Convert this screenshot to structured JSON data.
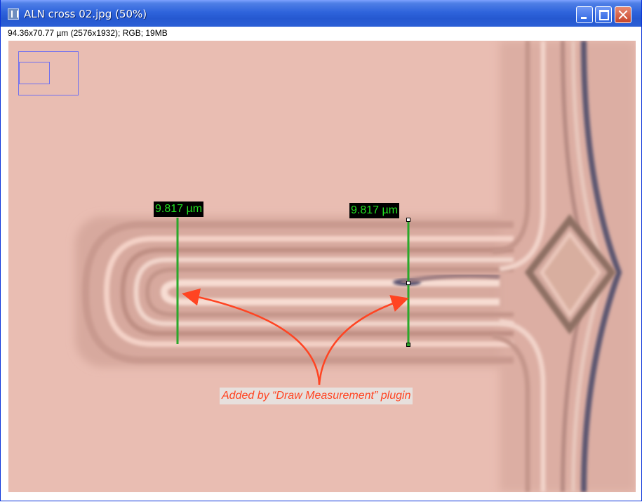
{
  "window": {
    "title": "ALN cross 02.jpg (50%)",
    "info_line": "94.36x70.77 µm (2576x1932); RGB; 19MB",
    "buttons": {
      "minimize": "minimize",
      "maximize": "maximize",
      "close": "close"
    }
  },
  "measurements": [
    {
      "label": "9.817 µm"
    },
    {
      "label": "9.817 µm"
    }
  ],
  "annotation": {
    "text": "Added by “Draw Measurement” plugin",
    "color": "#ff4422"
  },
  "colors": {
    "titlebar": "#2558d0",
    "measure_line": "#2aa82a",
    "measure_text": "#22e022",
    "arrow": "#ff4422",
    "navigator": "#6f6ff0"
  }
}
